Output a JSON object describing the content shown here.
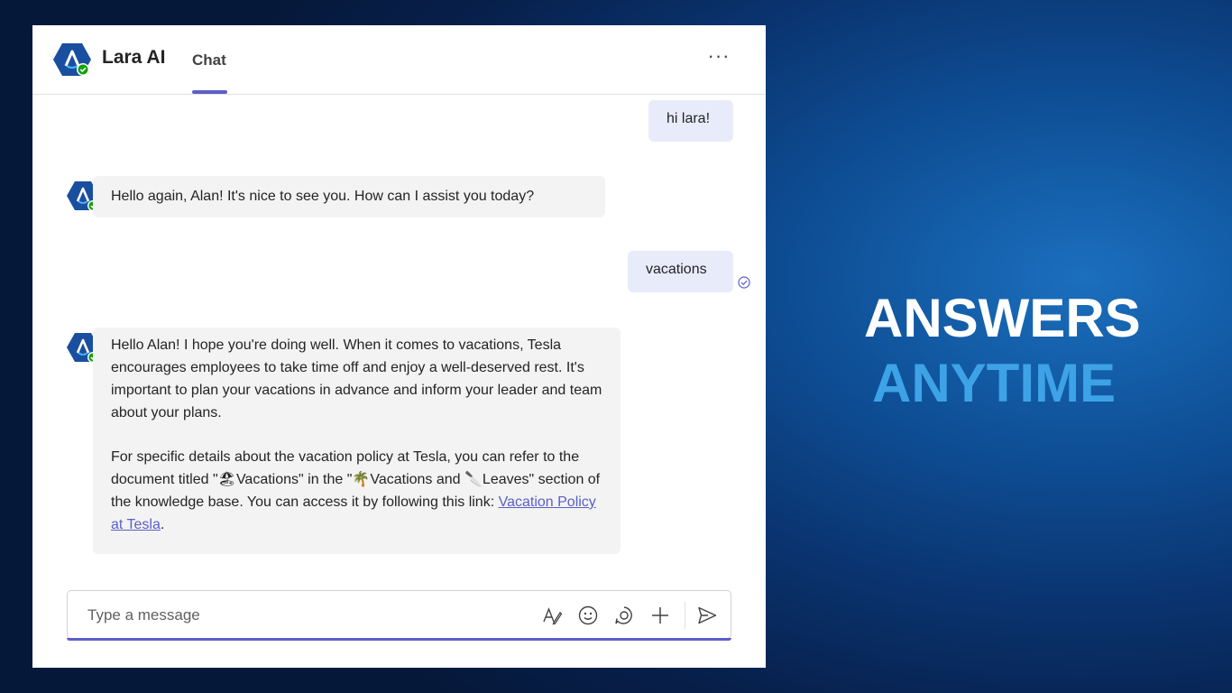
{
  "header": {
    "app_name": "Lara AI",
    "tab_label": "Chat",
    "more_icon": "more-horizontal-icon",
    "accent_color": "#5b5fc7"
  },
  "messages": [
    {
      "sender": "user",
      "text": "hi lara!"
    },
    {
      "sender": "bot",
      "text": "Hello again, Alan! It's nice to see you. How can I assist you today?"
    },
    {
      "sender": "user",
      "text": "vacations",
      "status_icon": "read-receipt-icon"
    },
    {
      "sender": "bot",
      "paragraph1": "Hello Alan! I hope you're doing well. When it comes to vacations, Tesla encourages employees to take time off and enjoy a well-deserved rest. It's important to plan your vacations in advance and inform your leader and team about your plans.",
      "paragraph2_text": "For specific details about the vacation policy at Tesla, you can refer to the document titled \"🏖Vacations\" in the \"🌴Vacations and 🔪Leaves\" section of the knowledge base. You can access it by following this link: ",
      "link_text": "Vacation Policy at Tesla",
      "trailing": "."
    }
  ],
  "compose": {
    "placeholder": "Type a message",
    "icons": [
      "format-icon",
      "emoji-icon",
      "loop-icon",
      "add-icon",
      "send-icon"
    ]
  },
  "tagline": {
    "line1": "ANSWERS",
    "line2": "ANYTIME",
    "line1_color": "#ffffff",
    "line2_color": "#3ea2e6"
  }
}
